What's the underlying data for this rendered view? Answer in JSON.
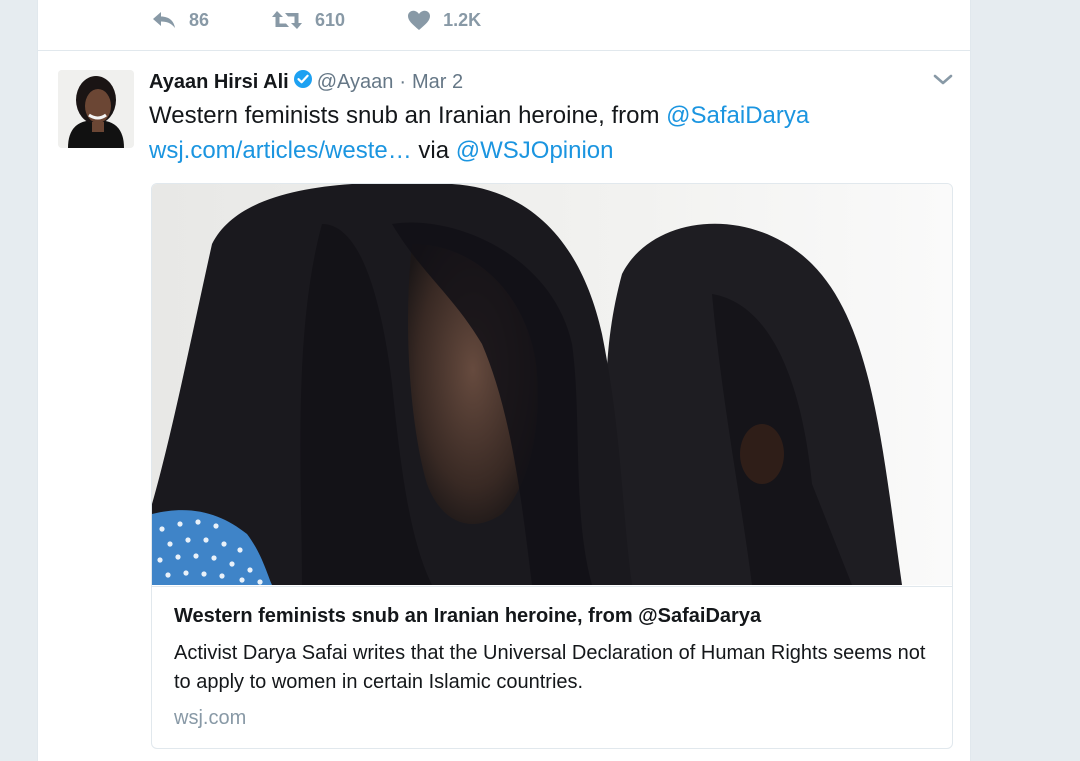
{
  "previous_tweet": {
    "actions": {
      "reply_count": "86",
      "retweet_count": "610",
      "like_count": "1.2K"
    }
  },
  "tweet": {
    "author_name": "Ayaan Hirsi Ali",
    "handle": "@Ayaan",
    "separator": "·",
    "time": "Mar 2",
    "text_main": "Western feminists snub an Iranian heroine, from ",
    "mention_author": "@SafaiDarya",
    "url_text": "wsj.com/articles/weste…",
    "via_text": " via ",
    "mention_source": "@WSJOpinion",
    "verified": true
  },
  "card": {
    "title": "Western feminists snub an Iranian heroine, from @SafaiDarya",
    "description": "Activist Darya Safai writes that the Universal Declaration of Human Rights seems not to apply to women in certain Islamic countries.",
    "domain": "wsj.com"
  },
  "colors": {
    "link": "#1b95e0",
    "muted": "#8899a6",
    "verified": "#1da1f2",
    "page_background": "#e6ecf0"
  }
}
